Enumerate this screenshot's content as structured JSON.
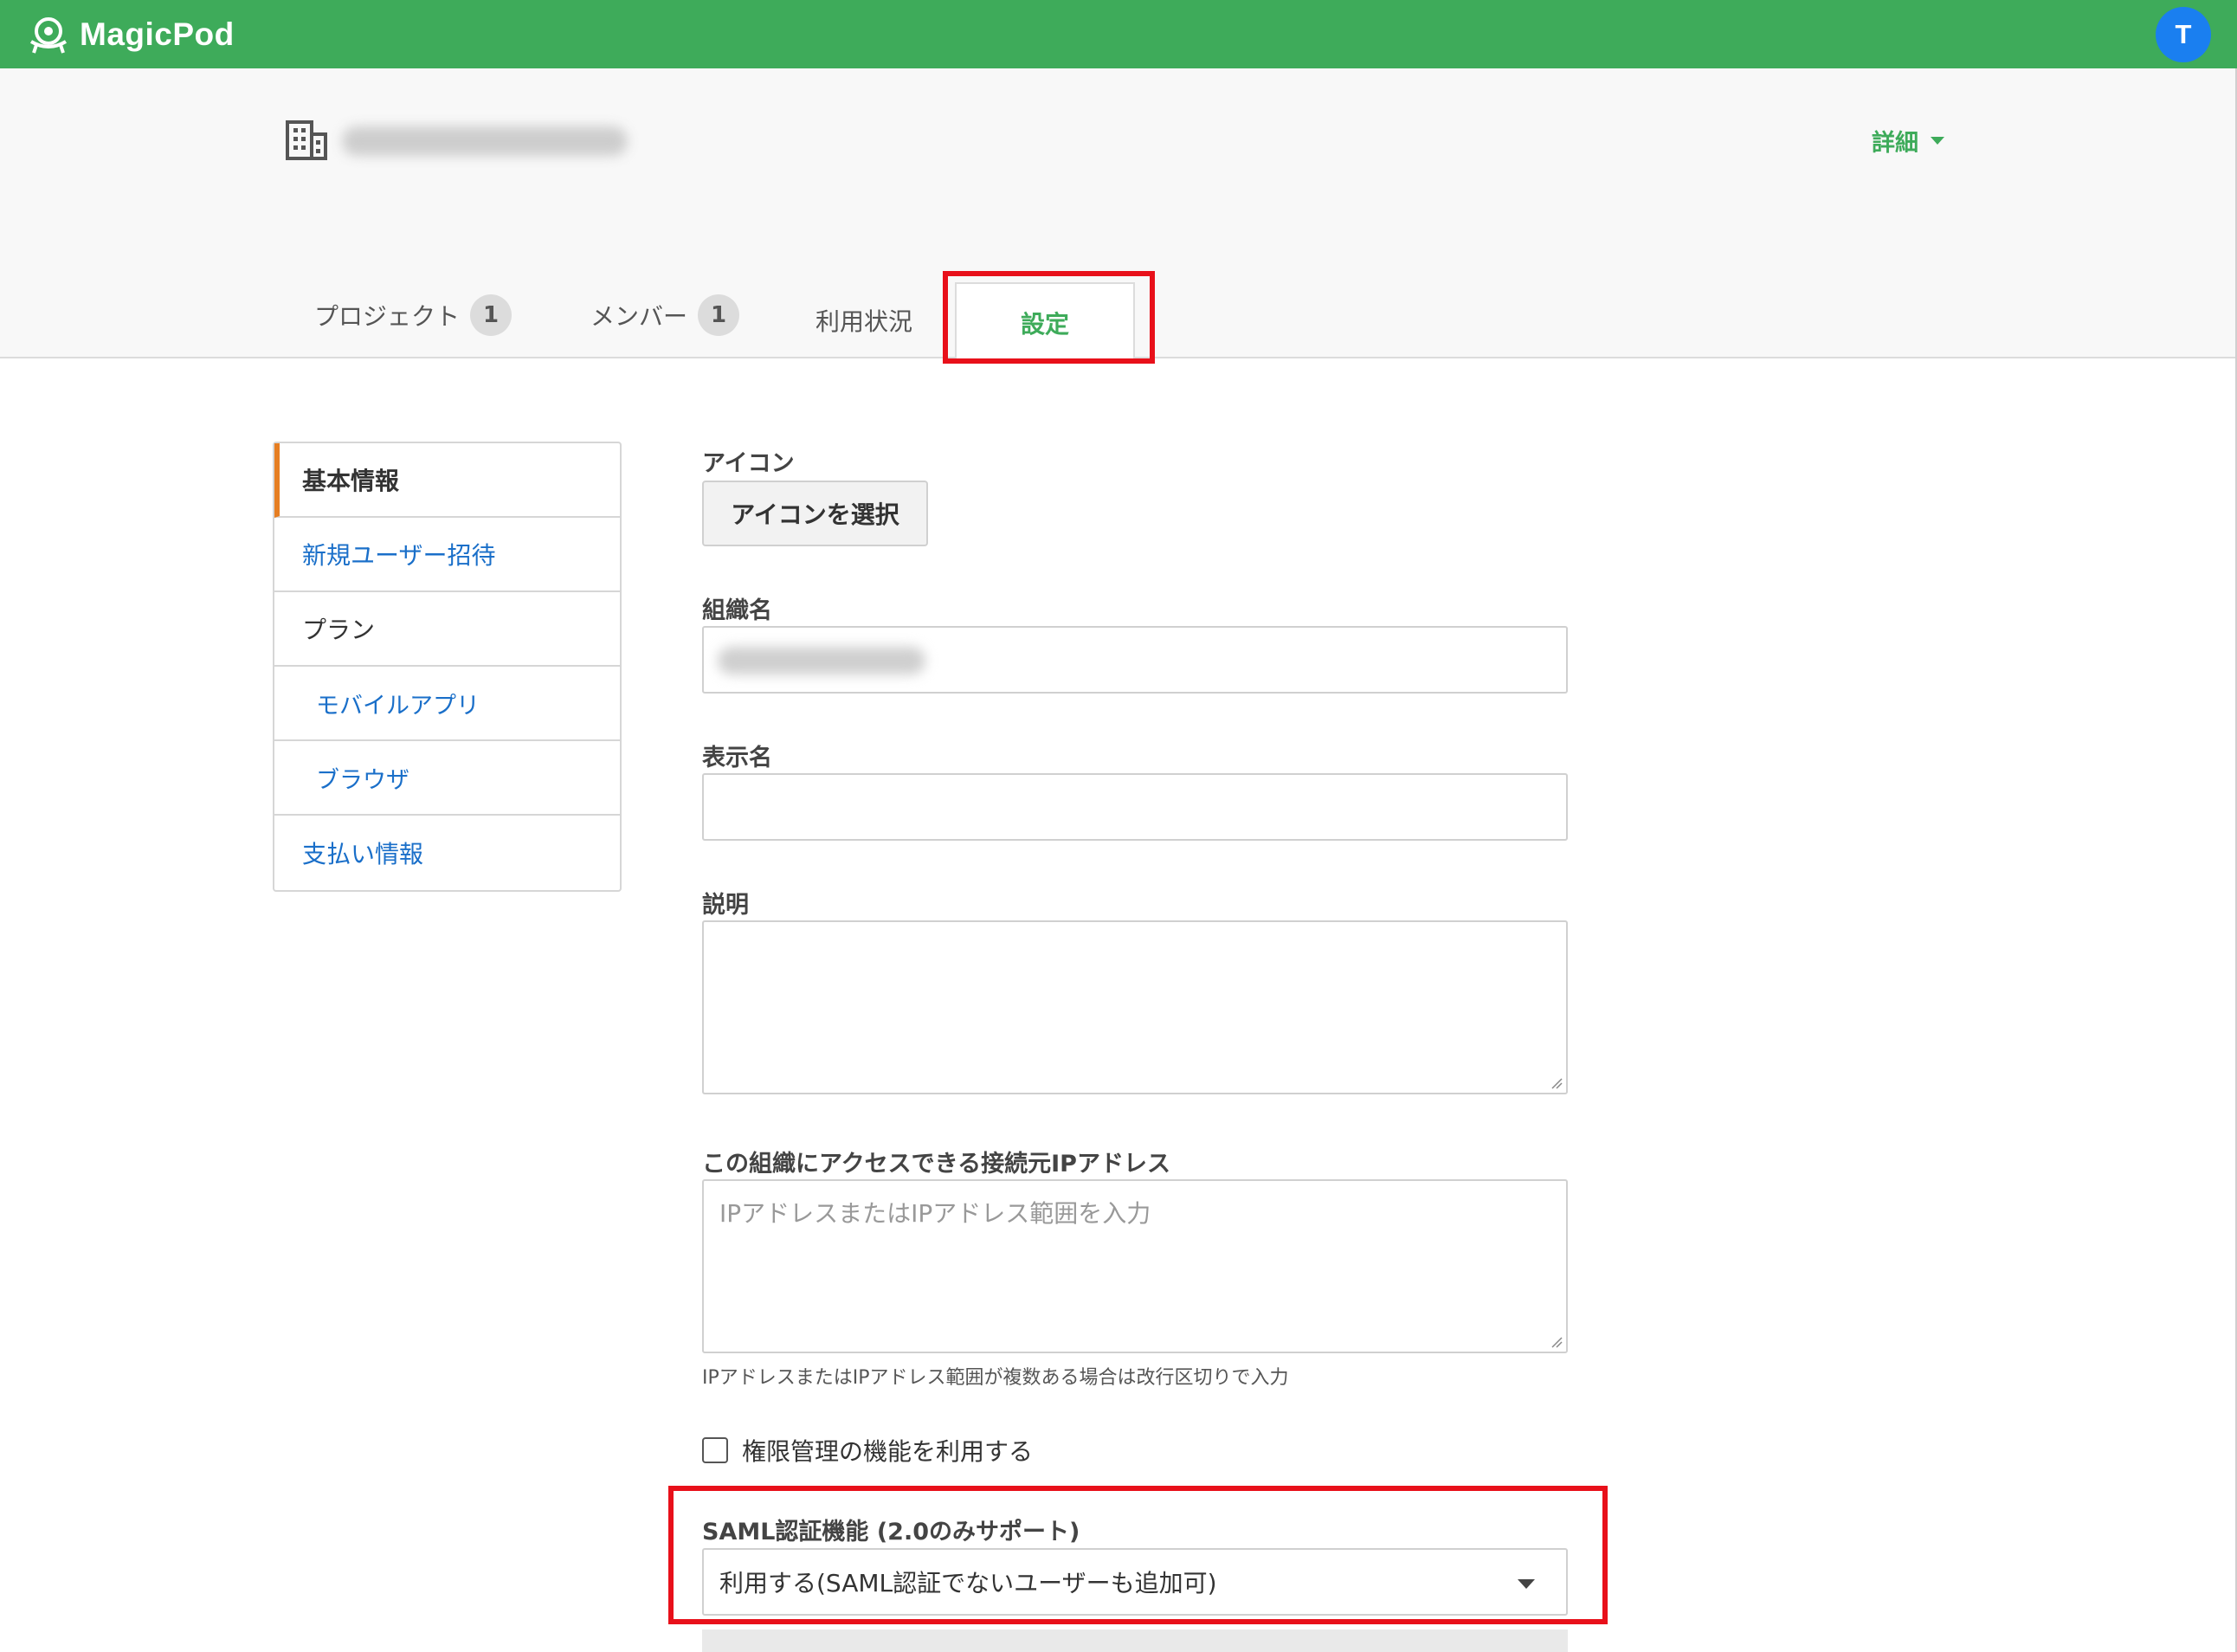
{
  "app": {
    "name": "MagicPod",
    "user_initial": "T"
  },
  "header": {
    "details_label": "詳細"
  },
  "tabs": [
    {
      "label": "プロジェクト",
      "badge": "1"
    },
    {
      "label": "メンバー",
      "badge": "1"
    },
    {
      "label": "利用状況"
    },
    {
      "label": "設定",
      "active": true
    }
  ],
  "sidebar": {
    "items": [
      {
        "label": "基本情報"
      },
      {
        "label": "新規ユーザー招待"
      },
      {
        "label": "プラン"
      },
      {
        "label": "モバイルアプリ"
      },
      {
        "label": "ブラウザ"
      },
      {
        "label": "支払い情報"
      }
    ]
  },
  "form": {
    "icon_label": "アイコン",
    "icon_button": "アイコンを選択",
    "org_name_label": "組織名",
    "display_name_label": "表示名",
    "description_label": "説明",
    "ip_label": "この組織にアクセスできる接続元IPアドレス",
    "ip_placeholder": "IPアドレスまたはIPアドレス範囲を入力",
    "ip_help": "IPアドレスまたはIPアドレス範囲が複数ある場合は改行区切りで入力",
    "permission_checkbox": "権限管理の機能を利用する",
    "saml_label": "SAML認証機能 (2.0のみサポート)",
    "saml_value": "利用する(SAML認証でないユーザーも追加可)"
  },
  "colors": {
    "brand": "#3eab5a",
    "highlight": "#e8101a",
    "link": "#1a6fc9",
    "active_marker": "#e67e22"
  }
}
